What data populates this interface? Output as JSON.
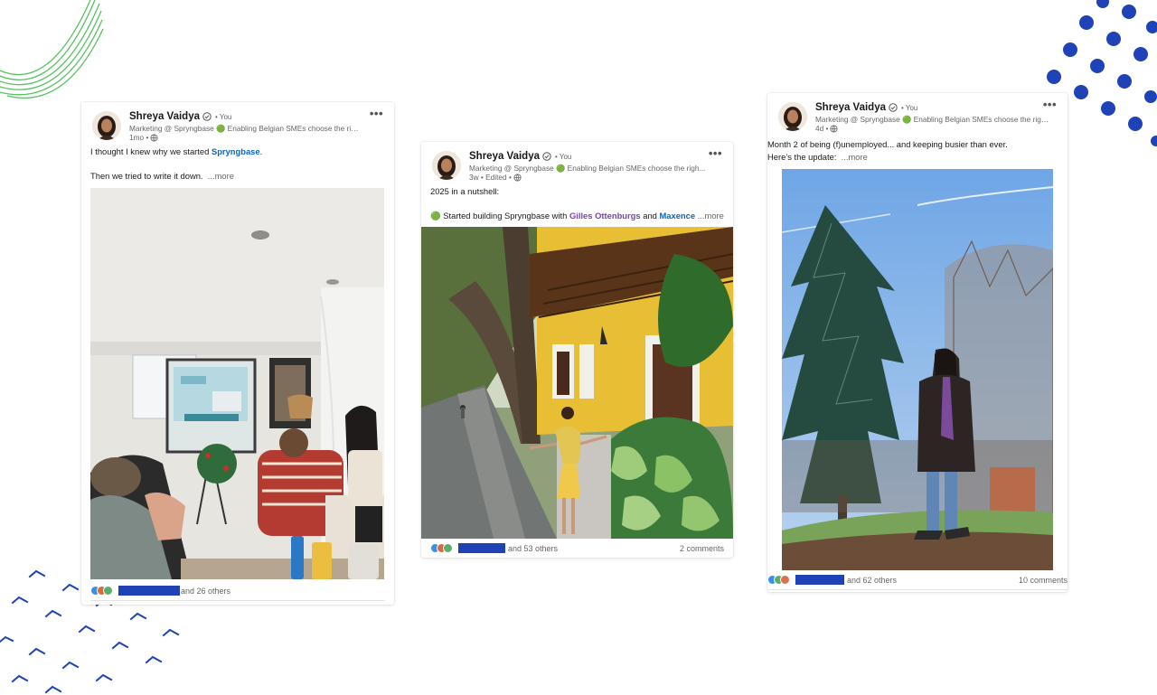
{
  "colors": {
    "accent_blue": "#1f43b6",
    "link_blue": "#0a66c2",
    "deco_green": "#58c163"
  },
  "posts": [
    {
      "author": "Shreya Vaidya",
      "you_label": "• You",
      "headline": "Marketing @ Spryngbase 🟢 Enabling Belgian SMEs choose the righ...",
      "meta": "1mo •",
      "text_line1_prefix": "I thought I knew why we started ",
      "text_line1_link": "Spryngbase",
      "text_line1_suffix": ".",
      "text_line2": "Then we tried to write it down.",
      "see_more": "...more",
      "reactions_text": "and 26 others",
      "comments": ""
    },
    {
      "author": "Shreya Vaidya",
      "you_label": "• You",
      "headline": "Marketing @ Spryngbase 🟢 Enabling Belgian SMEs choose the righ...",
      "meta": "3w • Edited •",
      "text_line1": "2025 in a nutshell:",
      "text_line2_prefix": "🟢 Started building Spryngbase with ",
      "text_line2_link1": "Gilles Ottenburgs",
      "text_line2_and": " and ",
      "text_line2_link2": "Maxence",
      "see_more": "...more",
      "reactions_text": "and 53 others",
      "comments": "2 comments"
    },
    {
      "author": "Shreya Vaidya",
      "you_label": "• You",
      "headline": "Marketing @ Spryngbase 🟢 Enabling Belgian SMEs choose the righ...",
      "meta": "4d •",
      "text_line1": "Month 2 of being (f)unemployed... and keeping busier than ever.",
      "text_line2": "Here’s the update:",
      "see_more": "...more",
      "reactions_text": "and 62 others",
      "comments": "10 comments"
    }
  ]
}
